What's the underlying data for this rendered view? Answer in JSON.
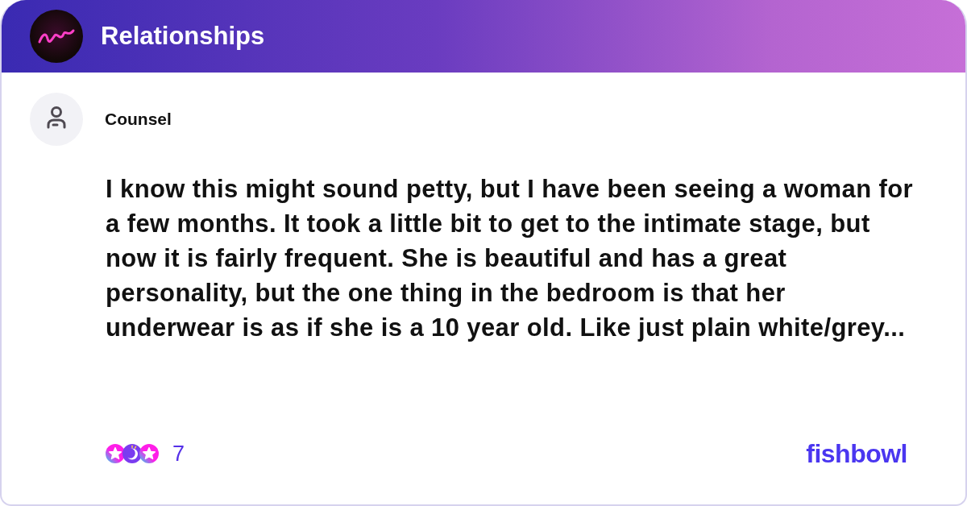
{
  "header": {
    "title": "Relationships"
  },
  "post": {
    "author": "Counsel",
    "body": "I know this might sound petty, but I have been seeing a woman for a few months. It took a little bit to get to the intimate stage, but now it is fairly frequent. She is beautiful and has a great personality, but the one thing in the bedroom is that her underwear is as if she is a 10 year old. Like just plain white/grey..."
  },
  "reactions": {
    "count": "7"
  },
  "brand": {
    "logo_text": "fishbowl"
  }
}
